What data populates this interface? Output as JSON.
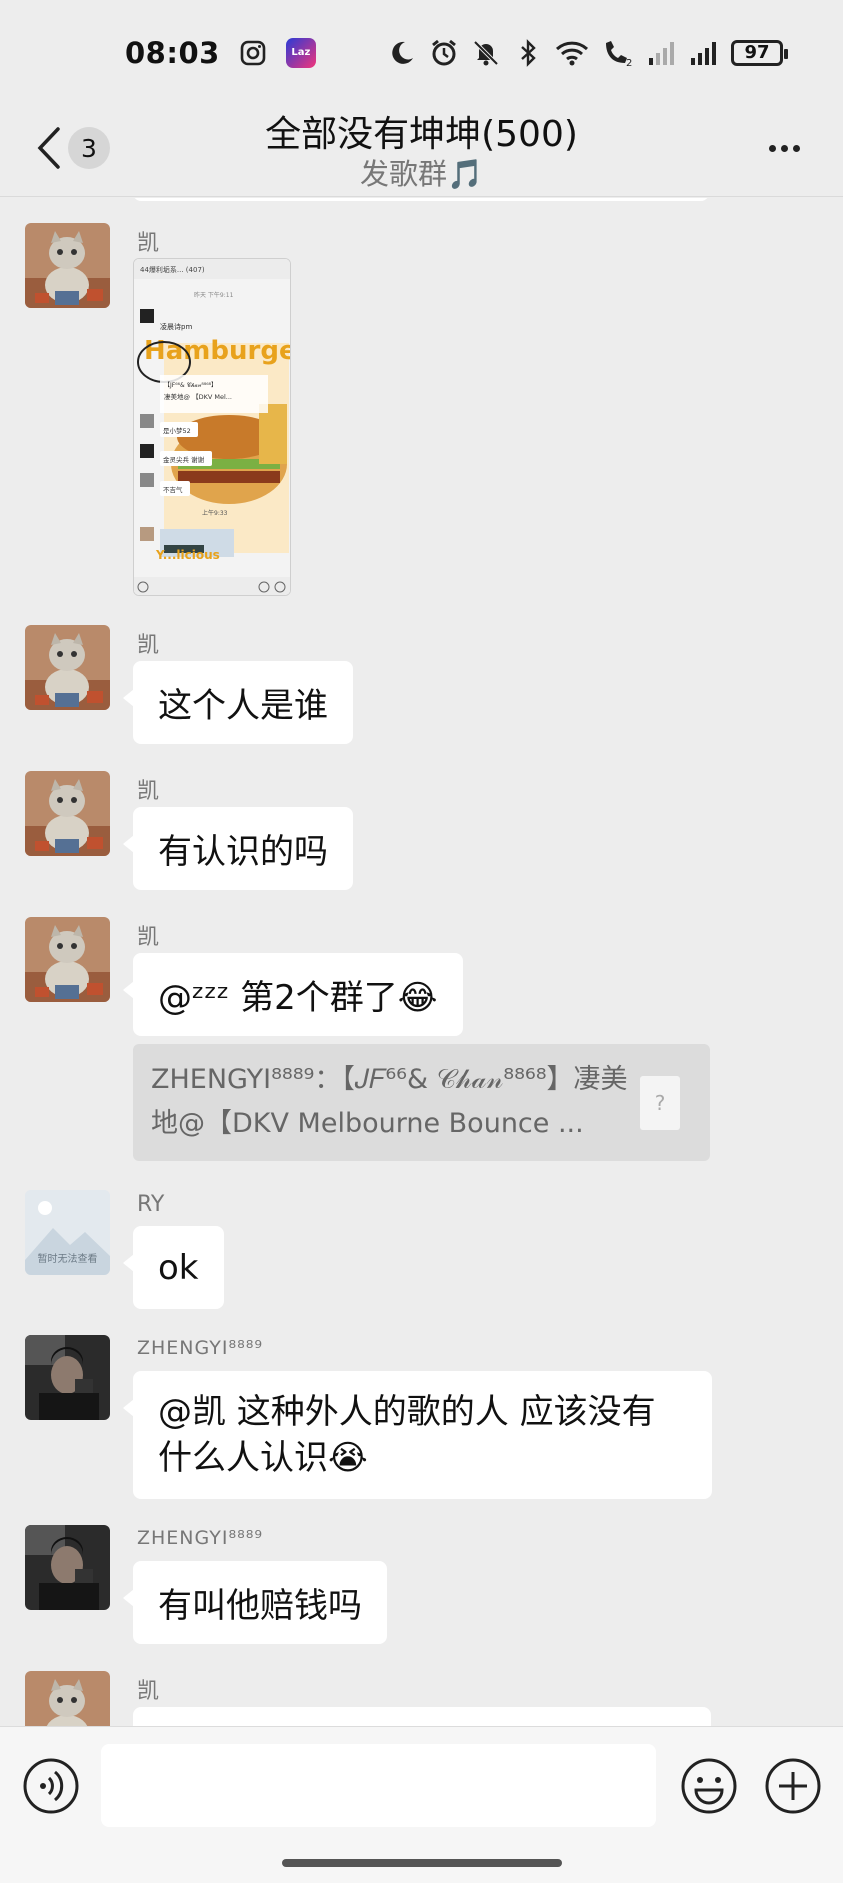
{
  "status_bar": {
    "time": "08:03",
    "app_badge": "Laz",
    "battery": "97",
    "icons": [
      "instagram-icon",
      "lazada-icon",
      "moon-icon",
      "alarm-icon",
      "mute-bell-icon",
      "bluetooth-icon",
      "wifi-icon",
      "call-sim2-icon",
      "signal-weak-icon",
      "signal-full-icon",
      "battery-icon"
    ]
  },
  "header": {
    "back_badge": "3",
    "title": "全部没有坤坤(500)",
    "subtitle": "发歌群🎵"
  },
  "messages": [
    {
      "sender": "凯",
      "type": "image"
    },
    {
      "sender": "凯",
      "text": "这个人是谁"
    },
    {
      "sender": "凯",
      "text": "有认识的吗"
    },
    {
      "sender": "凯",
      "text": "@ᶻᶻᶻ 第2个群了😂",
      "quote": "ZHENGYI⁸⁸⁸⁹：【𝐽𝐹⁶⁶& 𝒞𝒽𝒶𝓃⁸⁸⁶⁸】凄美地@【DKV Melbourne Bounce ..."
    },
    {
      "sender": "RY",
      "text": "ok",
      "avatar_caption": "暂时无法查看"
    },
    {
      "sender": "ZHENGYI⁸⁸⁸⁹",
      "text": "@凯  这种外人的歌的人 应该没有什么人认识😭"
    },
    {
      "sender": "ZHENGYI⁸⁸⁸⁹",
      "text": "有叫他赔钱吗"
    },
    {
      "sender": "凯"
    }
  ],
  "thumbnail": {
    "header": "44爆利垢系... (407)",
    "timestamp": "昨天 下午9:11",
    "name1": "凌晨诗pm",
    "big_word": "Hamburger",
    "quote_line1": "【JF⁶⁶& 𝒞𝒽𝒶𝓃⁸⁸⁶⁸】",
    "quote_line2": "凄美地@ 【DKV Mel...",
    "chip1": "是小梦52",
    "chip2": "金灵尖兵 谢谢",
    "chip3": "不吉气",
    "time2": "上午9:33",
    "bottom_word": "Y...licious"
  },
  "colors": {
    "background": "#ededed",
    "bubble": "#ffffff",
    "quote_bg": "#dcdcdc",
    "input_bar": "#f6f6f6"
  }
}
